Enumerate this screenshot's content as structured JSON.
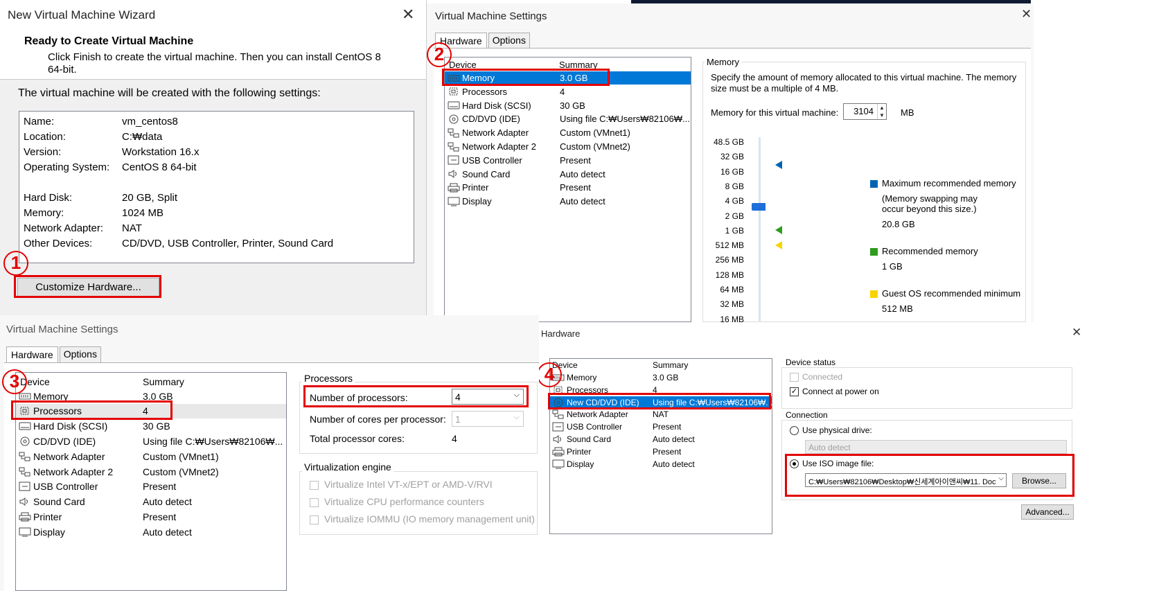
{
  "wizard": {
    "title": "New Virtual Machine Wizard",
    "heading": "Ready to Create Virtual Machine",
    "subtext_line1": "Click Finish to create the virtual machine. Then you can install CentOS 8",
    "subtext_line2": "64-bit.",
    "intro": "The virtual machine will be created with the following settings:",
    "settings": [
      {
        "label": "Name:",
        "value": "vm_centos8"
      },
      {
        "label": "Location:",
        "value": "C:₩data"
      },
      {
        "label": "Version:",
        "value": "Workstation 16.x"
      },
      {
        "label": "Operating System:",
        "value": "CentOS 8 64-bit"
      },
      {
        "label": "Hard Disk:",
        "value": "20 GB, Split"
      },
      {
        "label": "Memory:",
        "value": "1024 MB"
      },
      {
        "label": "Network Adapter:",
        "value": "NAT"
      },
      {
        "label": "Other Devices:",
        "value": "CD/DVD, USB Controller, Printer, Sound Card"
      }
    ],
    "customize_button": "Customize Hardware...",
    "step": "1"
  },
  "vms_memory": {
    "title": "Virtual Machine Settings",
    "tabs": [
      "Hardware",
      "Options"
    ],
    "col_device": "Device",
    "col_summary": "Summary",
    "devices": [
      {
        "name": "Memory",
        "summary": "3.0 GB",
        "icon": "memory-icon"
      },
      {
        "name": "Processors",
        "summary": "4",
        "icon": "cpu-icon"
      },
      {
        "name": "Hard Disk (SCSI)",
        "summary": "30 GB",
        "icon": "disk-icon"
      },
      {
        "name": "CD/DVD (IDE)",
        "summary": "Using file C:₩Users₩82106₩...",
        "icon": "cd-icon"
      },
      {
        "name": "Network Adapter",
        "summary": "Custom (VMnet1)",
        "icon": "network-icon"
      },
      {
        "name": "Network Adapter 2",
        "summary": "Custom (VMnet2)",
        "icon": "network-icon"
      },
      {
        "name": "USB Controller",
        "summary": "Present",
        "icon": "usb-icon"
      },
      {
        "name": "Sound Card",
        "summary": "Auto detect",
        "icon": "speaker-icon"
      },
      {
        "name": "Printer",
        "summary": "Present",
        "icon": "printer-icon"
      },
      {
        "name": "Display",
        "summary": "Auto detect",
        "icon": "monitor-icon"
      }
    ],
    "memory_group": "Memory",
    "memory_desc1": "Specify the amount of memory allocated to this virtual machine. The memory",
    "memory_desc2": "size must be a multiple of 4 MB.",
    "memory_label": "Memory for this virtual machine:",
    "memory_value": "3104",
    "memory_unit": "MB",
    "scale": [
      "48.5 GB",
      "32 GB",
      "16 GB",
      "8 GB",
      "4 GB",
      "2 GB",
      "1 GB",
      "512 MB",
      "256 MB",
      "128 MB",
      "64 MB",
      "32 MB",
      "16 MB"
    ],
    "legend_max": "Maximum recommended memory",
    "legend_max_note1": "(Memory swapping may",
    "legend_max_note2": "occur beyond this size.)",
    "legend_max_value": "20.8 GB",
    "legend_rec": "Recommended memory",
    "legend_rec_value": "1 GB",
    "legend_min": "Guest OS recommended minimum",
    "legend_min_value": "512 MB",
    "step": "2",
    "colors": {
      "max": "#0063b1",
      "rec": "#2e9c1d",
      "min": "#f7d400"
    }
  },
  "vms_processors": {
    "title": "Virtual Machine Settings",
    "tabs": [
      "Hardware",
      "Options"
    ],
    "col_device": "Device",
    "col_summary": "Summary",
    "devices": [
      {
        "name": "Memory",
        "summary": "3.0 GB"
      },
      {
        "name": "Processors",
        "summary": "4"
      },
      {
        "name": "Hard Disk (SCSI)",
        "summary": "30 GB"
      },
      {
        "name": "CD/DVD (IDE)",
        "summary": "Using file C:₩Users₩82106₩..."
      },
      {
        "name": "Network Adapter",
        "summary": "Custom (VMnet1)"
      },
      {
        "name": "Network Adapter 2",
        "summary": "Custom (VMnet2)"
      },
      {
        "name": "USB Controller",
        "summary": "Present"
      },
      {
        "name": "Sound Card",
        "summary": "Auto detect"
      },
      {
        "name": "Printer",
        "summary": "Present"
      },
      {
        "name": "Display",
        "summary": "Auto detect"
      }
    ],
    "proc_group": "Processors",
    "num_proc_label": "Number of processors:",
    "num_proc_value": "4",
    "cores_label": "Number of cores per processor:",
    "cores_value": "1",
    "total_label": "Total processor cores:",
    "total_value": "4",
    "virt_group": "Virtualization engine",
    "virt_options": [
      "Virtualize Intel VT-x/EPT or AMD-V/RVI",
      "Virtualize CPU performance counters",
      "Virtualize IOMMU (IO memory management unit)"
    ],
    "step": "3"
  },
  "hw_cd": {
    "title": "Hardware",
    "col_device": "Device",
    "col_summary": "Summary",
    "devices": [
      {
        "name": "Memory",
        "summary": "3.0 GB"
      },
      {
        "name": "Processors",
        "summary": "4"
      },
      {
        "name": "New CD/DVD (IDE)",
        "summary": "Using file C:₩Users₩82106₩..."
      },
      {
        "name": "Network Adapter",
        "summary": "NAT"
      },
      {
        "name": "USB Controller",
        "summary": "Present"
      },
      {
        "name": "Sound Card",
        "summary": "Auto detect"
      },
      {
        "name": "Printer",
        "summary": "Present"
      },
      {
        "name": "Display",
        "summary": "Auto detect"
      }
    ],
    "status_group": "Device status",
    "connected": "Connected",
    "connect_power": "Connect at power on",
    "connection_group": "Connection",
    "physical": "Use physical drive:",
    "physical_value": "Auto detect",
    "iso": "Use ISO image file:",
    "iso_path": "C:₩Users₩82106₩Desktop₩신세계아이앤씨₩11. Doc",
    "browse": "Browse...",
    "advanced": "Advanced...",
    "step": "4"
  }
}
